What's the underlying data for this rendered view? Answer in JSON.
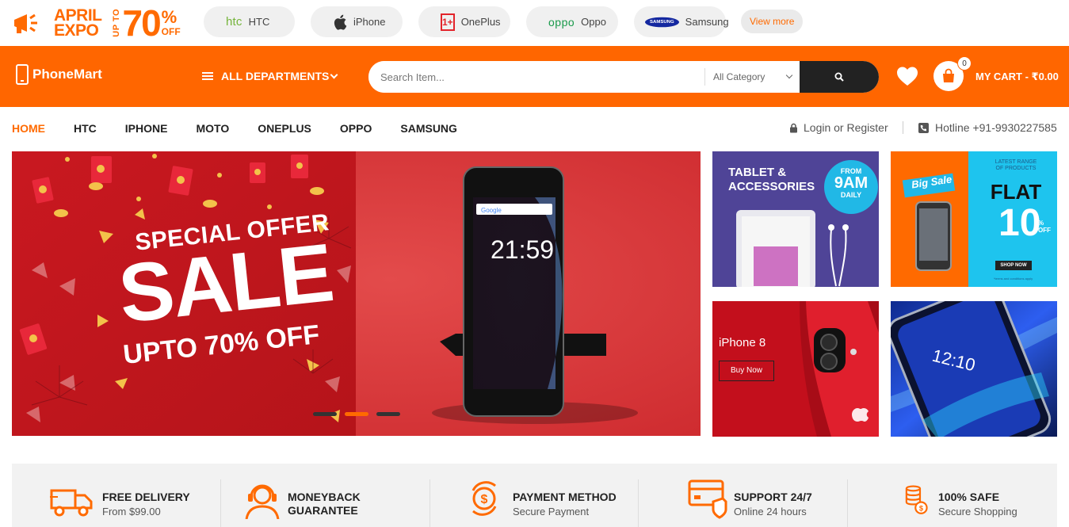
{
  "promo": {
    "expo_line1": "APRIL",
    "expo_line2": "EXPO",
    "upto": "UP TO",
    "percent": "70",
    "percent_sign": "%",
    "off": "OFF"
  },
  "brands": [
    {
      "logo_text": "htc",
      "label": "HTC",
      "icon": "htc-logo"
    },
    {
      "logo_text": "",
      "label": "iPhone",
      "icon": "apple-logo"
    },
    {
      "logo_text": "1+",
      "label": "OnePlus",
      "icon": "oneplus-logo"
    },
    {
      "logo_text": "oppo",
      "label": "Oppo",
      "icon": "oppo-logo"
    },
    {
      "logo_text": "SAMSUNG",
      "label": "Samsung",
      "icon": "samsung-logo"
    }
  ],
  "view_more": "View more",
  "header": {
    "site_name": "PhoneMart",
    "departments": "ALL DEPARTMENTS",
    "search_placeholder": "Search Item...",
    "category": "All Category",
    "cart_count": "0",
    "cart_label": "MY CART - ₹0.00",
    "accent_color": "#ff6600"
  },
  "nav": {
    "items": [
      "HOME",
      "HTC",
      "IPHONE",
      "MOTO",
      "ONEPLUS",
      "OPPO",
      "SAMSUNG"
    ],
    "login": "Login or Register",
    "hotline": "Hotline +91-9930227585"
  },
  "slider": {
    "line1": "SPECIAL OFFER",
    "line2": "SALE",
    "line3": "UPTO 70% OFF",
    "phone_time": "21:59",
    "phone_search": "Google"
  },
  "banners": {
    "tablet_title_1": "TABLET &",
    "tablet_title_2": "ACCESSORIES",
    "tablet_badge_1": "FROM",
    "tablet_badge_2": "9AM",
    "tablet_badge_3": "DAILY",
    "bigsale_tag": "Big Sale",
    "bigsale_sub_1": "LATEST RANGE",
    "bigsale_sub_2": "OF PRODUCTS",
    "bigsale_flat": "FLAT",
    "bigsale_num": "10",
    "bigsale_pct": "% OFF",
    "bigsale_btn": "SHOP NOW",
    "bigsale_terms": "*terms and conditions apply",
    "iphone_title": "iPhone 8",
    "iphone_btn": "Buy Now",
    "lock_time": "12:10"
  },
  "features": [
    {
      "title": "FREE DELIVERY",
      "sub": "From $99.00",
      "icon": "truck-icon"
    },
    {
      "title": "MONEYBACK",
      "sub": "GUARANTEE",
      "icon": "support-headset-icon"
    },
    {
      "title": "PAYMENT METHOD",
      "sub": "Secure Payment",
      "icon": "payment-cycle-icon"
    },
    {
      "title": "SUPPORT 24/7",
      "sub": "Online 24 hours",
      "icon": "card-shield-icon"
    },
    {
      "title": "100% SAFE",
      "sub": "Secure Shopping",
      "icon": "coins-icon"
    }
  ]
}
